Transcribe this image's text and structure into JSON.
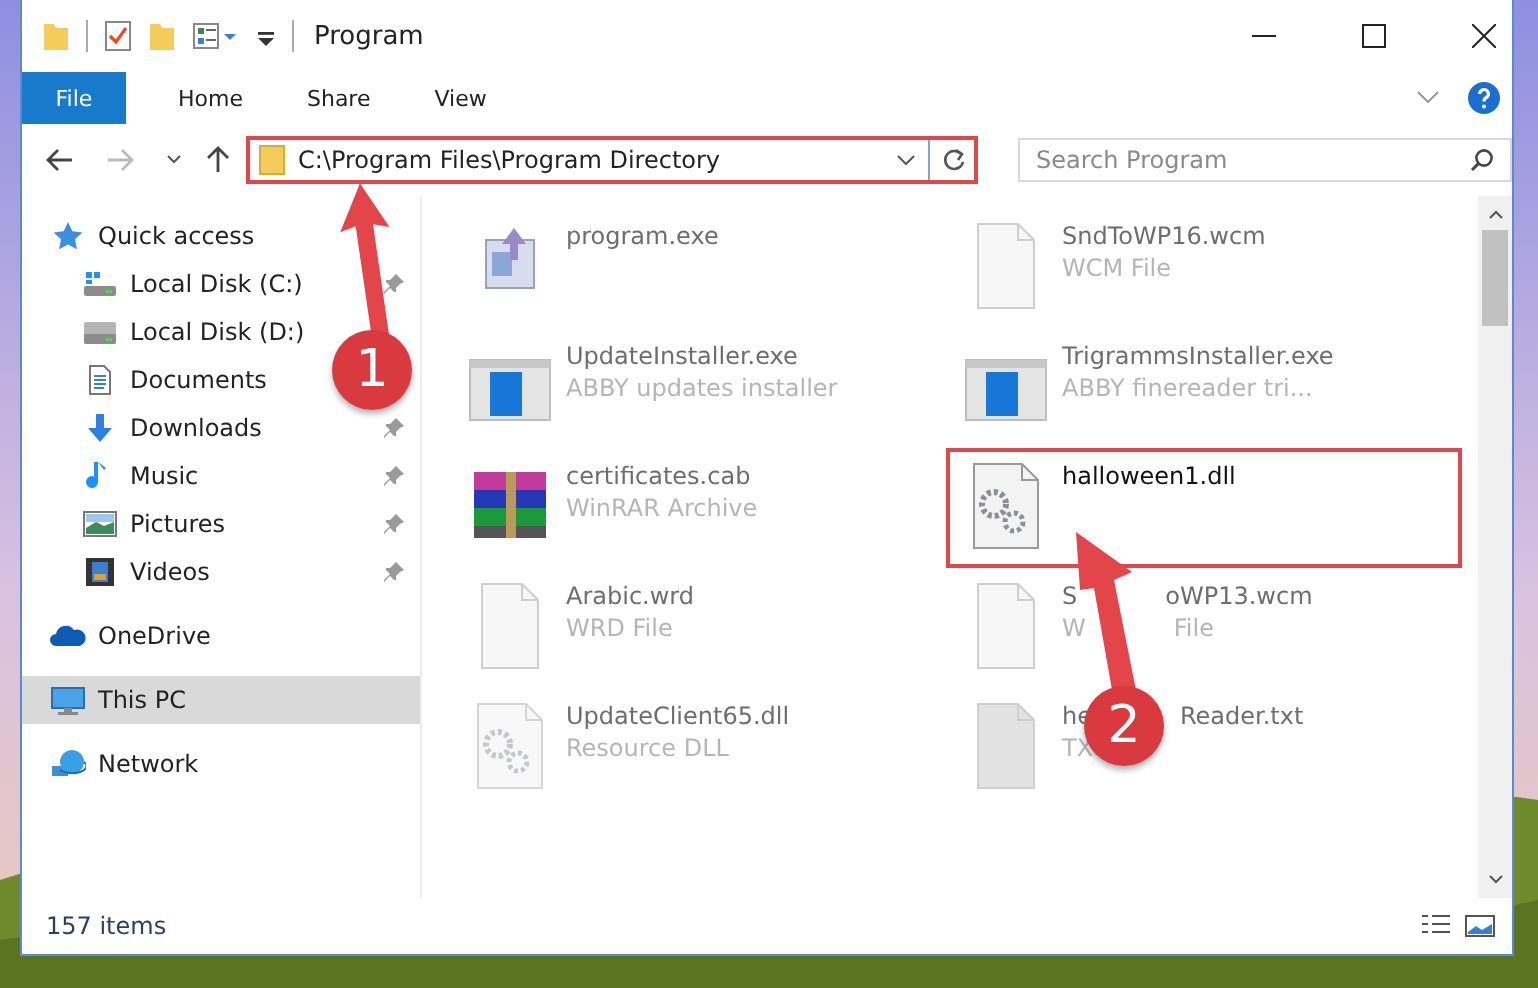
{
  "window": {
    "title": "Program"
  },
  "ribbon": {
    "tabs": [
      {
        "label": "File",
        "kind": "file"
      },
      {
        "label": "Home",
        "kind": "tab"
      },
      {
        "label": "Share",
        "kind": "tab"
      },
      {
        "label": "View",
        "kind": "tab"
      }
    ]
  },
  "address_bar": {
    "path": "C:\\Program Files\\Program Directory",
    "highlighted": true
  },
  "search": {
    "placeholder": "Search Program"
  },
  "sidebar": {
    "items": [
      {
        "label": "Quick access",
        "kind": "star",
        "selected": false,
        "children": [
          {
            "label": "Local Disk (C:)",
            "kind": "system-drive",
            "pinned": true,
            "selected": false
          },
          {
            "label": "Local Disk (D:)",
            "kind": "drive",
            "pinned": false,
            "selected": false
          },
          {
            "label": "Documents",
            "kind": "documents",
            "pinned": false,
            "selected": false
          },
          {
            "label": "Downloads",
            "kind": "downloads",
            "pinned": true,
            "selected": false
          },
          {
            "label": "Music",
            "kind": "music",
            "pinned": true,
            "selected": false
          },
          {
            "label": "Pictures",
            "kind": "pictures",
            "pinned": true,
            "selected": false
          },
          {
            "label": "Videos",
            "kind": "videos",
            "pinned": true,
            "selected": false
          }
        ]
      },
      {
        "label": "OneDrive",
        "kind": "cloud",
        "selected": false
      },
      {
        "label": "This PC",
        "kind": "pc",
        "selected": true
      },
      {
        "label": "Network",
        "kind": "network",
        "selected": false
      }
    ]
  },
  "files": [
    {
      "name": "program.exe",
      "kind": "program",
      "highlighted": false
    },
    {
      "name": "SndToWP16.wcm",
      "type": "WCM File",
      "kind": "blank",
      "highlighted": false
    },
    {
      "name": "UpdateInstaller.exe",
      "type": "ABBY updates installer",
      "kind": "installer",
      "highlighted": false
    },
    {
      "name": "TrigrammsInstaller.exe",
      "type": "ABBY finereader tri...",
      "kind": "installer",
      "highlighted": false
    },
    {
      "name": "certificates.cab",
      "type": "WinRAR Archive",
      "kind": "archive",
      "highlighted": false
    },
    {
      "name": "halloween1.dll",
      "kind": "dll",
      "highlighted": true
    },
    {
      "name": "Arabic.wrd",
      "type": "WRD File",
      "kind": "blank",
      "highlighted": false
    },
    {
      "name": "S",
      "name_tail": "oWP13.wcm",
      "type": "W",
      "type_tail": "File",
      "kind": "blank",
      "highlighted": false
    },
    {
      "name": "UpdateClient65.dll",
      "type": "Resource DLL",
      "kind": "dll-faded",
      "highlighted": false
    },
    {
      "name": "he",
      "name_tail": "Reader.txt",
      "type": "TX",
      "kind": "text",
      "highlighted": false
    }
  ],
  "status_bar": {
    "item_count": "157 items"
  },
  "annotations": [
    {
      "number": "1"
    },
    {
      "number": "2"
    }
  ]
}
